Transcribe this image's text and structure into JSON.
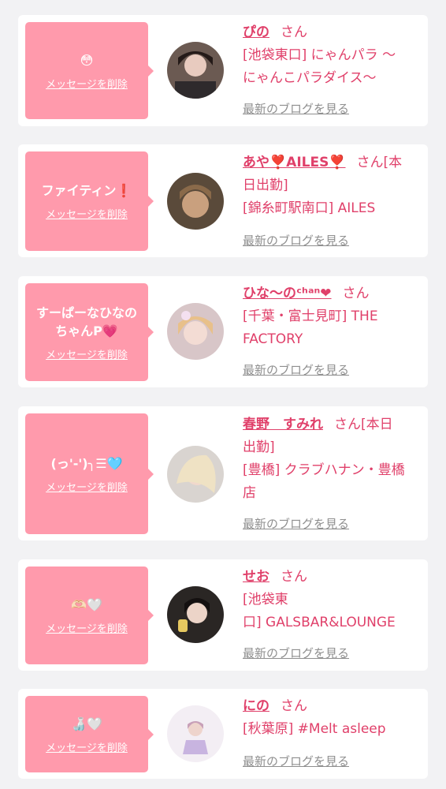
{
  "delete_label": "メッセージを削除",
  "blog_label": "最新のブログを見る",
  "colors": {
    "bubble": "#ff9aac",
    "accent": "#e0406a",
    "muted": "#8f8f8f",
    "background": "#f2f2f4"
  },
  "cards": [
    {
      "message": "😳",
      "name": "ぴの",
      "san": "さん",
      "shop_lines": [
        "[池袋東口] にゃんパラ 〜",
        "にゃんこパラダイス〜"
      ]
    },
    {
      "message": "ファイティン❗",
      "name": "あや❣️AILES❣️",
      "san": "さん[本",
      "shop_lines": [
        "日出勤]",
        "[錦糸町駅南口] AILES"
      ]
    },
    {
      "message_lines": [
        "すーぱーなひなの",
        "ちゃんP💗"
      ],
      "name": "ひな〜のᶜʰᵃⁿ❤",
      "san": "さん",
      "shop_lines": [
        "[千葉・富士見町] THE",
        "FACTORY"
      ]
    },
    {
      "message": "(っ'-')╮☰🩵",
      "name": "春野　すみれ",
      "san": "さん[本日",
      "shop_lines": [
        "出勤]",
        "[豊橋] クラブハナン・豊橋",
        "店"
      ]
    },
    {
      "message": "🫶🏻🤍",
      "name": "せお",
      "san": "さん",
      "shop_lines": [
        "[池袋東",
        "口] GALSBAR&LOUNGE"
      ]
    },
    {
      "message": "🍶🤍",
      "name": "にの",
      "san": "さん",
      "shop_lines": [
        "[秋葉原] #Melt asleep"
      ]
    }
  ]
}
